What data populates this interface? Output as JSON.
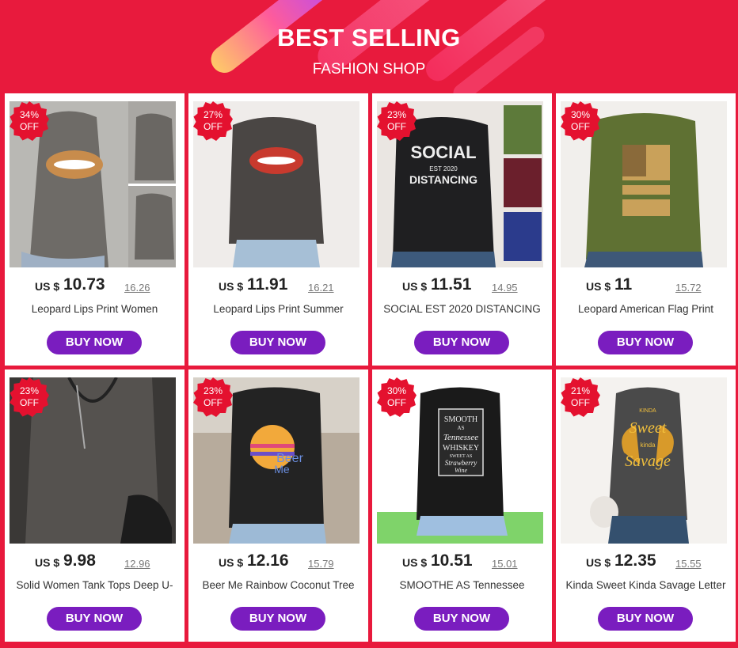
{
  "header": {
    "title": "BEST SELLING",
    "subtitle": "FASHION SHOP"
  },
  "colors": {
    "background": "#e8193c",
    "badge": "#e4112f",
    "button": "#7a1dbf"
  },
  "products": [
    {
      "discount_pct": "34%",
      "discount_label": "OFF",
      "currency": "US $",
      "price": "10.73",
      "old_price": "16.26",
      "name": "Leopard Lips Print Women",
      "button": "BUY NOW"
    },
    {
      "discount_pct": "27%",
      "discount_label": "OFF",
      "currency": "US $",
      "price": "11.91",
      "old_price": "16.21",
      "name": "Leopard Lips Print Summer",
      "button": "BUY NOW"
    },
    {
      "discount_pct": "23%",
      "discount_label": "OFF",
      "currency": "US $",
      "price": "11.51",
      "old_price": "14.95",
      "name": "SOCIAL EST  2020 DISTANCING",
      "button": "BUY NOW"
    },
    {
      "discount_pct": "30%",
      "discount_label": "OFF",
      "currency": "US $",
      "price": "11",
      "old_price": "15.72",
      "name": "Leopard American Flag Print",
      "button": "BUY NOW"
    },
    {
      "discount_pct": "23%",
      "discount_label": "OFF",
      "currency": "US $",
      "price": "9.98",
      "old_price": "12.96",
      "name": "Solid Women Tank Tops Deep U-",
      "button": "BUY NOW"
    },
    {
      "discount_pct": "23%",
      "discount_label": "OFF",
      "currency": "US $",
      "price": "12.16",
      "old_price": "15.79",
      "name": "Beer Me Rainbow Coconut Tree",
      "button": "BUY NOW"
    },
    {
      "discount_pct": "30%",
      "discount_label": "OFF",
      "currency": "US $",
      "price": "10.51",
      "old_price": "15.01",
      "name": "SMOOTHE AS  Tennessee",
      "button": "BUY NOW"
    },
    {
      "discount_pct": "21%",
      "discount_label": "OFF",
      "currency": "US $",
      "price": "12.35",
      "old_price": "15.55",
      "name": "Kinda Sweet Kinda Savage Letter",
      "button": "BUY NOW"
    }
  ],
  "shirt_prints": {
    "p3_line1": "SOCIAL",
    "p3_line2": "EST 2020",
    "p3_line3": "DISTANCING",
    "p6_line1": "Beer",
    "p6_line2": "Me",
    "p7_line1": "SMOOTH",
    "p7_line2": "AS",
    "p7_line3": "Tennessee",
    "p7_line4": "WHISKEY",
    "p7_line5": "SWEET AS",
    "p7_line6": "Strawberry",
    "p7_line7": "Wine",
    "p8_line1": "KINDA",
    "p8_line2": "Sweet",
    "p8_line3": "kinda",
    "p8_line4": "Savage"
  }
}
